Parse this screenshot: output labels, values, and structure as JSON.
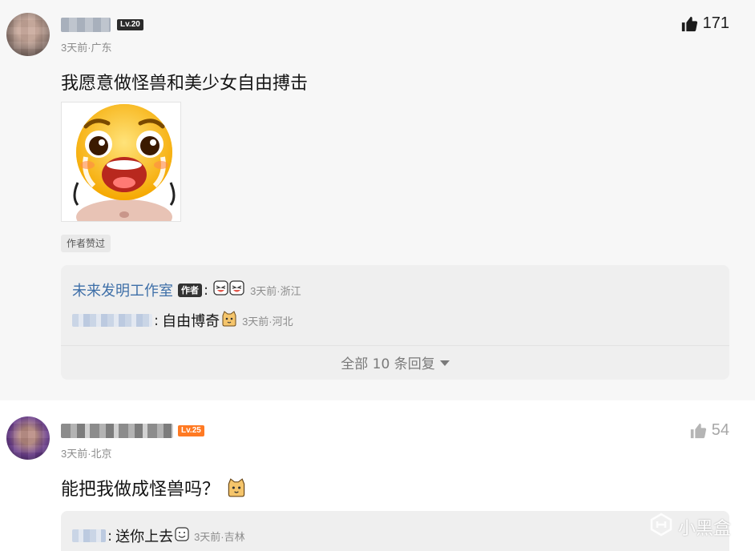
{
  "comments": [
    {
      "user_level": "Lv.20",
      "meta": "3天前·广东",
      "likes": "171",
      "text": "我愿意做怪兽和美少女自由搏击",
      "image_icon": "crying-emoji-sticker",
      "author_liked": "作者赞过",
      "replies": [
        {
          "name": "未来发明工作室",
          "badge": "作者",
          "colon": ":",
          "emoji": "laughing-emoji",
          "meta": "3天前·浙江"
        },
        {
          "colon": ":",
          "text": "自由博奇",
          "emoji": "cat-emoji",
          "meta": "3天前·河北"
        }
      ],
      "view_all": "全部 10 条回复"
    },
    {
      "user_level": "Lv.25",
      "meta": "3天前·北京",
      "likes": "54",
      "text": "能把我做成怪兽吗？",
      "emoji": "cat-emoji",
      "replies": [
        {
          "colon": ":",
          "text": "送你上去",
          "emoji": "smile-emoji",
          "meta": "3天前·吉林"
        }
      ]
    }
  ],
  "watermark": "小黑盒",
  "colors": {
    "level1_bg": "#2b2b2b",
    "level2_bg": "#ff7a23",
    "reply_name": "#3e6fa8",
    "meta_gray": "#8c8c8c"
  }
}
